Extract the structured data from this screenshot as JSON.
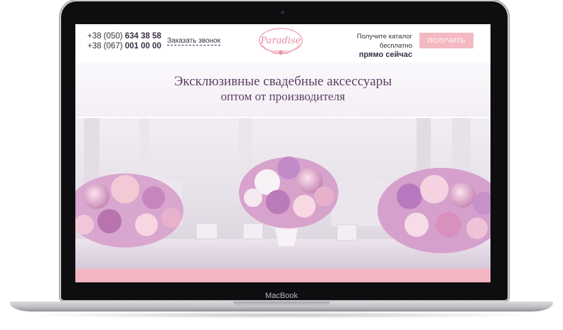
{
  "header": {
    "phone_1_prefix": "+38 (050)",
    "phone_1_number": "634 38 58",
    "phone_2_prefix": "+38 (067)",
    "phone_2_number": "001 00 00",
    "callback_label": "Заказать звонок",
    "logo_text": "Paradise",
    "catalog_line_1": "Получите каталог бесплатно",
    "catalog_line_2": "прямо сейчас",
    "get_button_label": "ПОЛУЧИТЬ"
  },
  "hero": {
    "title_line_1": "Эксклюзивные свадебные аксессуары",
    "title_line_2": "оптом от производителя"
  },
  "device": {
    "label": "MacBook"
  },
  "colors": {
    "accent_pink": "#f4b8c1",
    "title_purple": "#5b3f63"
  }
}
